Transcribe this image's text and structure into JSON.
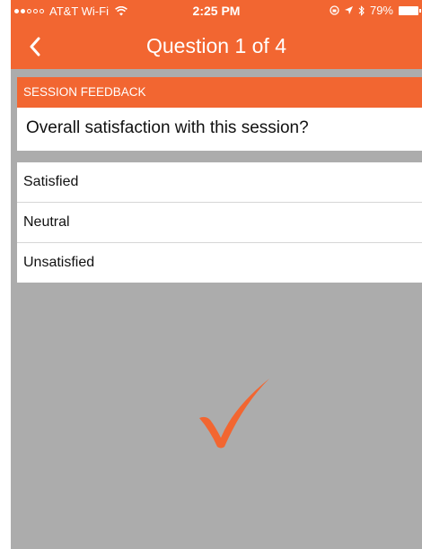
{
  "status_bar": {
    "carrier": "AT&T Wi-Fi",
    "time": "2:25 PM",
    "battery": "79%",
    "signal_full": 2,
    "signal_total": 5
  },
  "nav": {
    "back_icon": "chevron-left-icon",
    "title": "Question 1 of 4"
  },
  "survey": {
    "section": "SESSION FEEDBACK",
    "question": "Overall satisfaction with this session?",
    "options": [
      "Satisfied",
      "Neutral",
      "Unsatisfied"
    ]
  },
  "overlay": {
    "icon": "checkmark-icon",
    "color": "#f26631"
  },
  "colors": {
    "accent": "#f26631",
    "overlay_bg": "#acacac"
  }
}
